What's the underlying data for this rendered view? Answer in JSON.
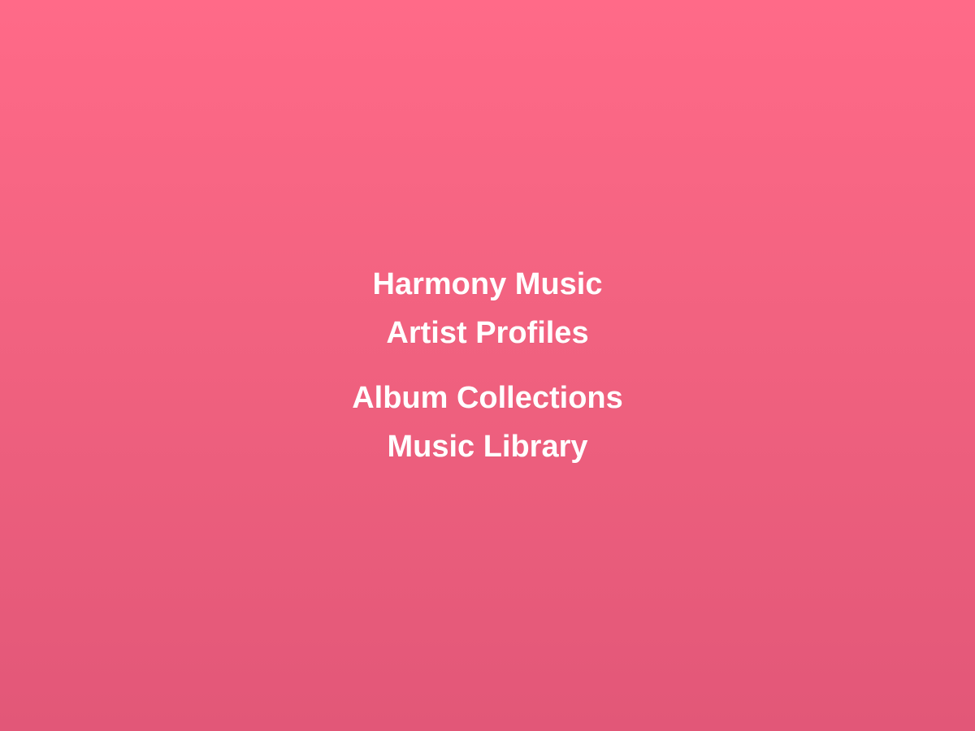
{
  "app": {
    "background_gradient": [
      "#ff6a88",
      "#e25778"
    ],
    "text_color": "#ffffff"
  },
  "menu": {
    "items": [
      {
        "label": "Harmony Music"
      },
      {
        "label": "Artist Profiles"
      },
      {
        "label": "Album Collections"
      },
      {
        "label": "Music Library"
      }
    ]
  }
}
